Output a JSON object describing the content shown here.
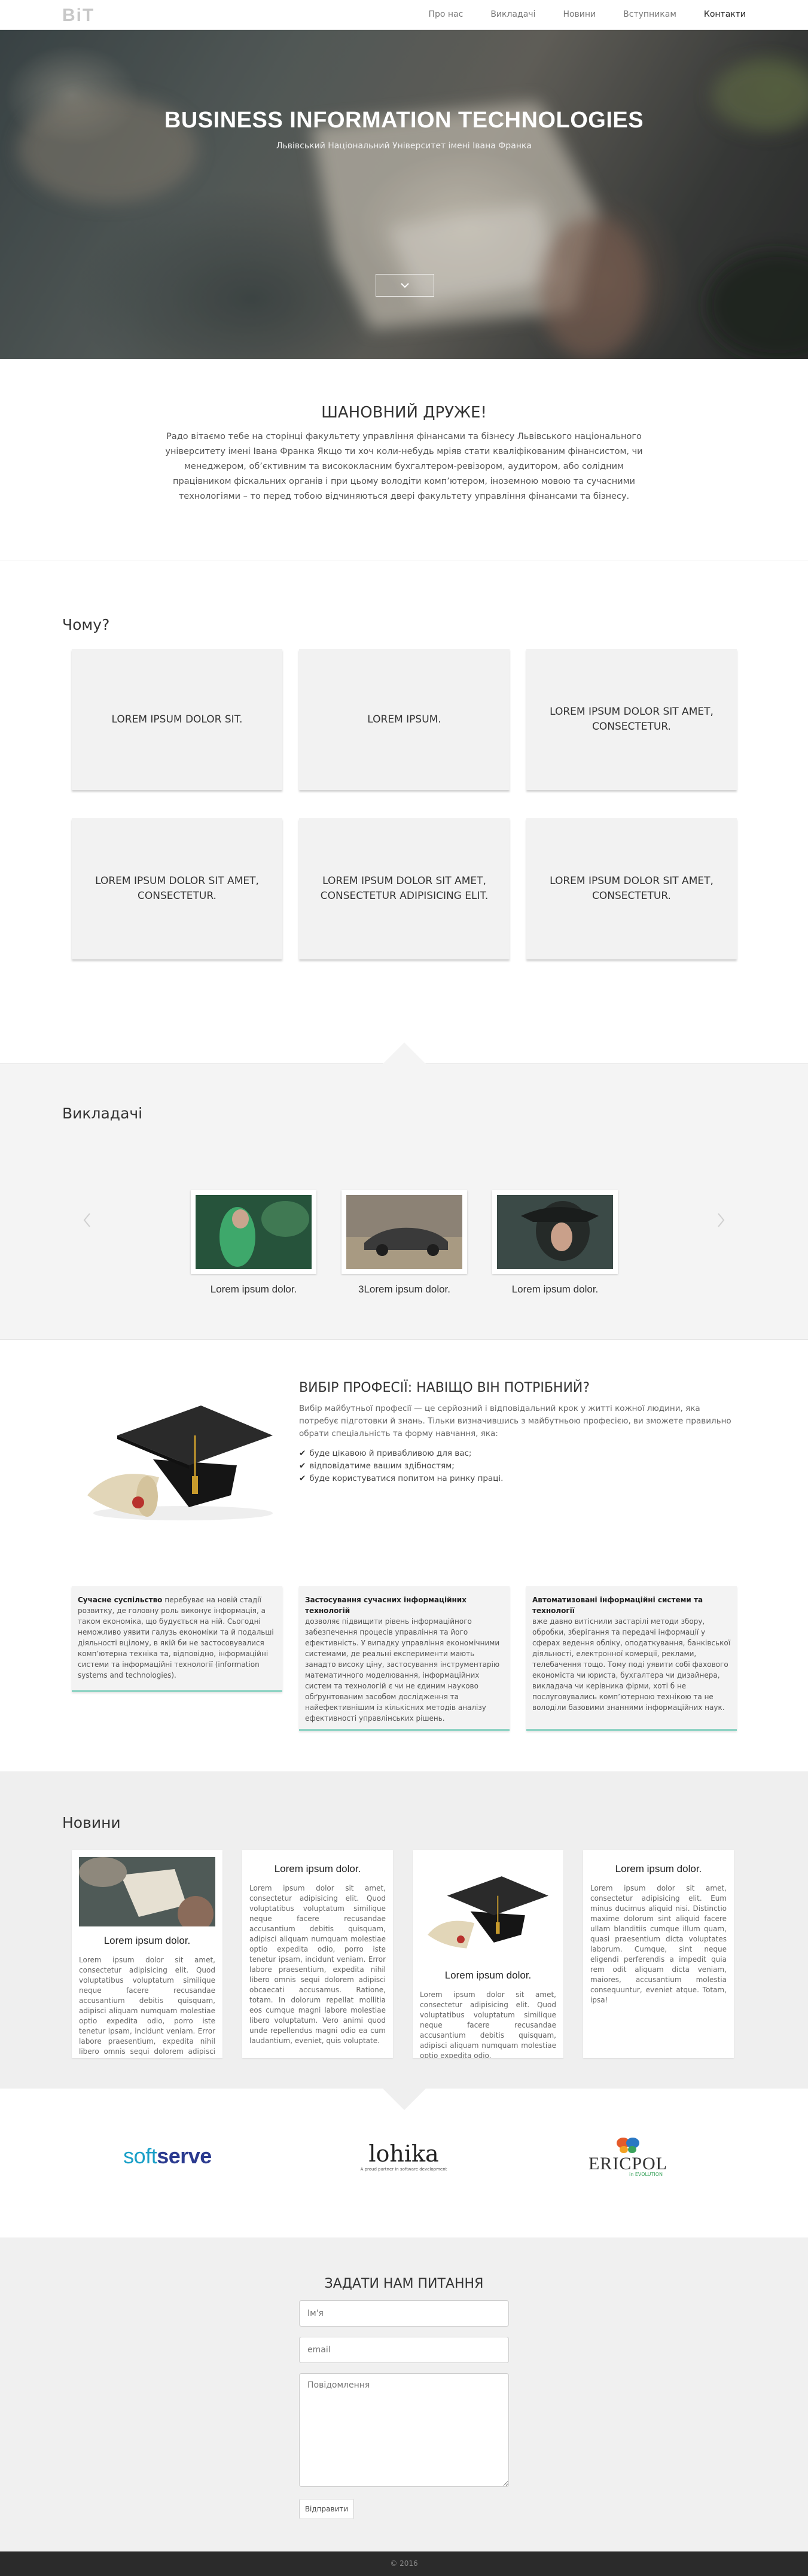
{
  "nav": {
    "brand": "BiT",
    "links": [
      "Про нас",
      "Викладачі",
      "Новини",
      "Вступникам",
      "Контакти"
    ]
  },
  "hero": {
    "title": "BUSINESS INFORMATION TECHNOLOGIES",
    "subtitle": "Львівський Національний Університет імені Івана Франка",
    "arrow_icon": "chevron-down-icon"
  },
  "intro": {
    "title": "ШАНОВНИЙ ДРУЖЕ!",
    "text": "Радо вітаємо тебе на сторінці факультету управління фінансами та бізнесу Львівського національного університету імені Івана Франка Якщо ти хоч коли-небудь мріяв стати кваліфікованим фінансистом, чи менеджером, об’єктивним та висококласним бухгалтером-ревізором, аудитором, або солідним працівником фіскальних органів і при цьому володіти комп’ютером, іноземною мовою та сучасними технологіями – то перед тобою відчиняються двері факультету управління фінансами та бізнесу."
  },
  "why": {
    "title": "Чому?",
    "cards": [
      "LOREM IPSUM DOLOR SIT.",
      "LOREM IPSUM.",
      "LOREM IPSUM DOLOR SIT AMET, CONSECTETUR.",
      "LOREM IPSUM DOLOR SIT AMET, CONSECTETUR.",
      "LOREM IPSUM DOLOR SIT AMET, CONSECTETUR ADIPISICING ELIT.",
      "LOREM IPSUM DOLOR SIT AMET, CONSECTETUR."
    ]
  },
  "teachers": {
    "title": "Викладачі",
    "prev_icon": "chevron-left-icon",
    "next_icon": "chevron-right-icon",
    "items": [
      {
        "name": "Lorem ipsum dolor."
      },
      {
        "name": "3Lorem ipsum dolor."
      },
      {
        "name": "Lorem ipsum dolor."
      }
    ]
  },
  "profession": {
    "title": "ВИБІР ПРОФЕСІЇ: НАВІЩО ВІН ПОТРІБНИЙ?",
    "text": "Вибір майбутньої професії — це серйозний і відповідальний крок у житті кожної людини, яка потребує підготовки й знань. Тільки визначившись з майбутньою професією, ви зможете правильно обрати спеціальність та форму навчання, яка:",
    "list": [
      "буде цікавою й привабливою для вас;",
      "відповідатиме вашим здібностям;",
      "буде користуватися попитом на ринку праці."
    ]
  },
  "info_cards": [
    {
      "title": "Сучасне суспільство",
      "text": "перебуває на новій стадії розвитку, де головну роль виконує інформація, а таком економіка, що будується на ній. Сьогодні неможливо уявити галузь економіки та й подальші діяльності вцілому, в якій би не застосовувалися комп’ютерна техніка та, відповідно, інформаційні системи та інформаційні технології (information systems and technologies)."
    },
    {
      "title": "Застосування сучасних інформаційних технологій",
      "text": "дозволяє підвищити рівень інформаційного забезпечення процесів управління та його ефективність. У випадку управління економічними системами, де реальні експерименти мають занадто високу ціну, застосування інструментарію математичного моделювання, інформаційних систем та технологій є чи не єдиним науково обґрунтованим засобом дослідження та найефективнішим із кількісних методів аналізу ефективності управлінських рішень."
    },
    {
      "title": "Автоматизовані інформаційні системи та технології",
      "text": "вже давно витіснили застарілі методи збору, обробки, зберігання та передачі інформації у сферах ведення обліку, оподаткування, банківської діяльності, електронної комерції, реклами, телебачення тощо. Тому поді уявити собі фахового економіста чи юриста, бухгалтера чи дизайнера, викладача чи керівника фірми, хоті б не послуговувались комп’ютерною технікою та не володіли базовими знаннями інформаційних наук."
    }
  ],
  "news": {
    "title": "Новини",
    "items": [
      {
        "title": "Lorem ipsum dolor.",
        "text": "Lorem ipsum dolor sit amet, consectetur adipisicing elit. Quod voluptatibus voluptatum similique neque facere recusandae accusantium debitis quisquam, adipisci aliquam numquam molestiae optio expedita odio, porro iste tenetur ipsam, incidunt veniam. Error labore praesentium, expedita nihil libero omnis sequi dolorem adipisci obcaecati accusamus."
      },
      {
        "title": "Lorem ipsum dolor.",
        "text": "Lorem ipsum dolor sit amet, consectetur adipisicing elit. Quod voluptatibus voluptatum similique neque facere recusandae accusantium debitis quisquam, adipisci aliquam numquam molestiae optio expedita odio, porro iste tenetur ipsam, incidunt veniam. Error labore praesentium, expedita nihil libero omnis sequi dolorem adipisci obcaecati accusamus. Ratione, totam. In dolorum repellat mollitia eos cumque magni labore molestiae libero voluptatum. Vero animi quod unde repellendus magni odio ea cum laudantium, eveniet, quis voluptate."
      },
      {
        "title": "Lorem ipsum dolor.",
        "text": "Lorem ipsum dolor sit amet, consectetur adipisicing elit. Quod voluptatibus voluptatum similique neque facere recusandae accusantium debitis quisquam, adipisci aliquam numquam molestiae optio expedita odio."
      },
      {
        "title": "Lorem ipsum dolor.",
        "text": "Lorem ipsum dolor sit amet, consectetur adipisicing elit. Eum minus ducimus aliquid nisi. Distinctio maxime dolorum sint aliquid facere ullam blanditiis cumque illum quam, quasi praesentium dicta voluptates laborum. Cumque, sint neque eligendi perferendis a impedit quia rem odit aliquam dicta veniam, maiores, accusantium molestia consequuntur, eveniet atque. Totam, ipsa!"
      }
    ]
  },
  "partners": [
    {
      "name": "softserve",
      "color_a": "#1aa0c8",
      "color_b": "#2b3a8f"
    },
    {
      "name": "lohika",
      "tagline": "A proud partner in software development"
    },
    {
      "name": "ERICPOL",
      "tagline": "in EVOLUTION"
    }
  ],
  "contact": {
    "title": "ЗАДАТИ НАМ ПИТАННЯ",
    "name_placeholder": "Ім'я",
    "email_placeholder": "email",
    "message_placeholder": "Повідомлення",
    "submit_label": "Відправити"
  },
  "footer": {
    "text": "© 2016"
  }
}
